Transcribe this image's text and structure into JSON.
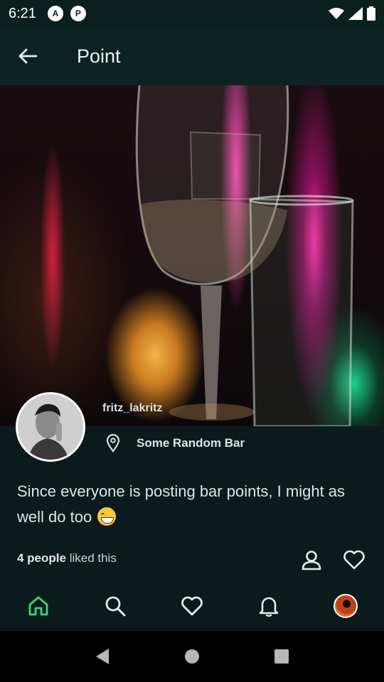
{
  "status_bar": {
    "time": "6:21",
    "app_icons": [
      "A",
      "P"
    ],
    "icons": [
      "wifi-icon",
      "signal-icon",
      "battery-icon"
    ]
  },
  "app_bar": {
    "title": "Point",
    "back_icon": "arrow-left-icon"
  },
  "post": {
    "author": "fritz_lakritz",
    "location": "Some Random Bar",
    "caption": "Since everyone is posting bar points, I might as well do too",
    "likes_count": "4 people",
    "likes_suffix": " liked this"
  },
  "bottom_nav": {
    "items": [
      "home-icon",
      "search-icon",
      "heart-icon",
      "bell-icon",
      "profile-avatar"
    ],
    "active": "home-icon"
  },
  "colors": {
    "background": "#0b1a1c",
    "app_bar": "#0d2323",
    "accent": "#3fd37a",
    "text": "#e8eeee"
  }
}
